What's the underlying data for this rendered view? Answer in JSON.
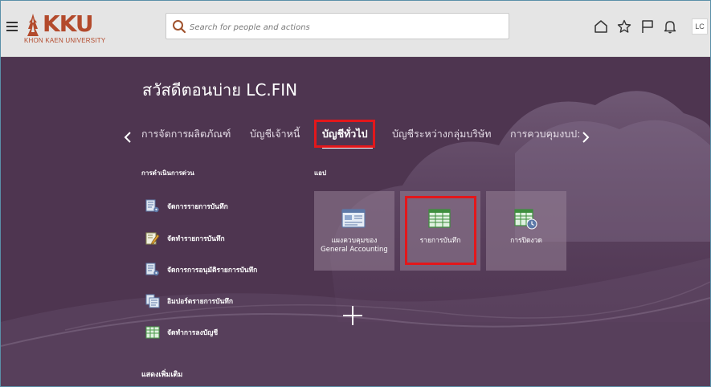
{
  "header": {
    "logo_text": "KKU",
    "logo_subtitle": "KHON KAEN UNIVERSITY",
    "search_placeholder": "Search for people and actions",
    "avatar_initials": "LC"
  },
  "greeting": "สวัสดีตอนบ่าย LC.FIN",
  "tabs": [
    {
      "label": "การจัดการผลิตภัณฑ์",
      "active": false
    },
    {
      "label": "บัญชีเจ้าหนี้",
      "active": false
    },
    {
      "label": "บัญชีทั่วไป",
      "active": true
    },
    {
      "label": "บัญชีระหว่างกลุ่มบริษัท",
      "active": false
    },
    {
      "label": "การควบคุมงบป:",
      "active": false
    }
  ],
  "quick_actions": {
    "title": "การดำเนินการด่วน",
    "items": [
      {
        "label": "จัดการรายการบันทึก",
        "icon": "manage-journals-icon"
      },
      {
        "label": "จัดทำรายการบันทึก",
        "icon": "create-journal-icon"
      },
      {
        "label": "จัดการการอนุมัติรายการบันทึก",
        "icon": "approve-journals-icon"
      },
      {
        "label": "อิมปอร์ตรายการบันทึก",
        "icon": "import-journals-icon"
      },
      {
        "label": "จัดทำการลงบัญชี",
        "icon": "create-accounting-icon"
      }
    ],
    "show_more": "แสดงเพิ่มเติม"
  },
  "apps": {
    "title": "แอป",
    "tiles": [
      {
        "label": "แผงควบคุมของ General Accounting",
        "icon": "dashboard-icon"
      },
      {
        "label": "รายการบันทึก",
        "icon": "journals-icon"
      },
      {
        "label": "การปิดงวด",
        "icon": "period-close-icon"
      }
    ]
  },
  "colors": {
    "background": "#4e3550",
    "highlight": "#e3171b",
    "logo": "#b34a2c"
  }
}
